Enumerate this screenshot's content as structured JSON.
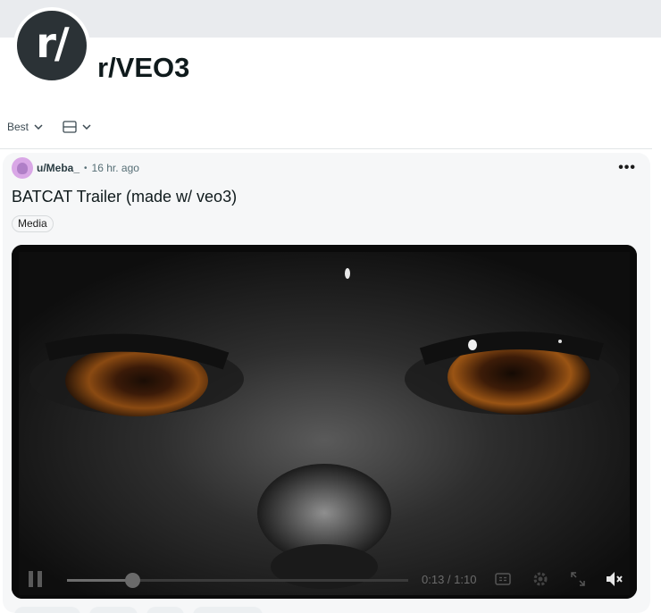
{
  "subreddit": {
    "avatar_text": "r/",
    "name": "r/VEO3"
  },
  "toolbar": {
    "sort_label": "Best"
  },
  "post": {
    "username": "u/Meba_",
    "separator": "•",
    "time": "16 hr. ago",
    "more_label": "•••",
    "title": "BATCAT Trailer (made w/ veo3)",
    "flair": "Media",
    "video": {
      "timecode": "0:13 / 1:10",
      "progress": 0.19,
      "muted": true
    }
  },
  "colors": {
    "banner": "#e9ebee",
    "avatar_bg": "#2b3236",
    "post_bg": "#f6f7f8",
    "eye_color": "#8a4a12"
  },
  "icons": {
    "sort": "chevron-down-icon",
    "view": "card-view-icon",
    "more": "more-options-icon",
    "pause": "pause-icon",
    "captions": "captions-icon",
    "settings": "gear-icon",
    "fullscreen": "fullscreen-icon",
    "mute": "muted-speaker-icon"
  }
}
